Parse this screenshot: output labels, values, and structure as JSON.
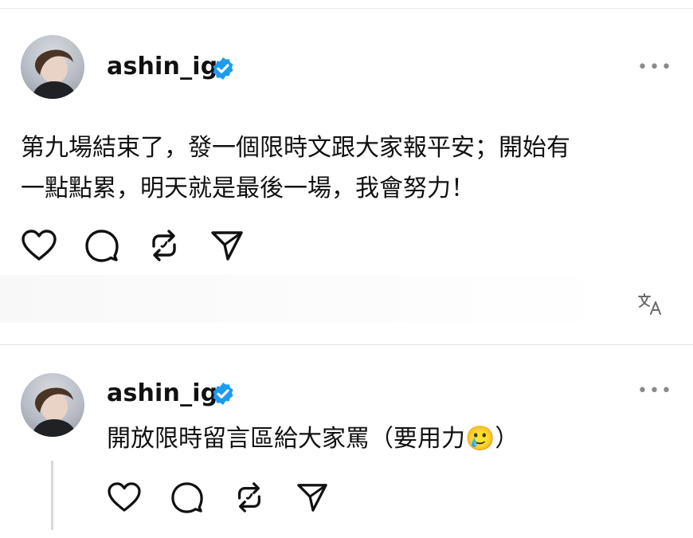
{
  "posts": [
    {
      "username": "ashin_ig",
      "more_label": "•••",
      "text_lines": [
        "第九場結束了，發一個限時文跟大家報平安；開始有",
        "一點點累，明天就是最後一場，我會努力！"
      ],
      "icons": {
        "like": "heart-icon",
        "comment": "comment-icon",
        "repost": "repost-icon",
        "share": "send-icon",
        "translate": "translate-icon"
      }
    },
    {
      "username": "ashin_ig",
      "more_label": "•••",
      "text_lines": [
        "開放限時留言區給大家罵（要用力🥲）"
      ],
      "icons": {
        "like": "heart-icon",
        "comment": "comment-icon",
        "repost": "repost-icon",
        "share": "send-icon"
      }
    }
  ],
  "colors": {
    "verified": "#1d9bf0",
    "text": "#111111",
    "muted": "#8a8a8a",
    "divider": "#e2e2e2"
  }
}
